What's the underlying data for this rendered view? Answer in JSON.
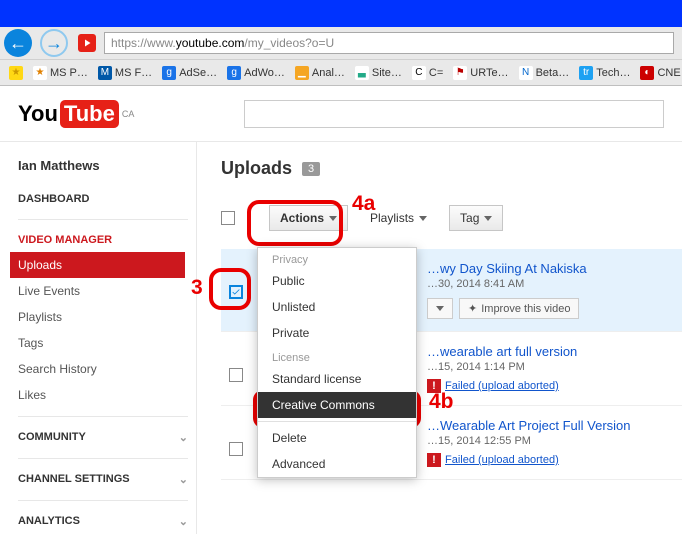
{
  "browser": {
    "url_scheme": "https://",
    "url_sub": "www.",
    "url_host": "youtube.com",
    "url_path": "/my_videos?o=U",
    "bookmarks": [
      {
        "label": "MS P…",
        "bg": "#fff",
        "fg": "#e08000",
        "ic": "★"
      },
      {
        "label": "MS F…",
        "bg": "#0058a8",
        "fg": "#fff",
        "ic": "M"
      },
      {
        "label": "AdSe…",
        "bg": "#1a73e8",
        "fg": "#fff",
        "ic": "g"
      },
      {
        "label": "AdWo…",
        "bg": "#1a73e8",
        "fg": "#fff",
        "ic": "g"
      },
      {
        "label": "Anal…",
        "bg": "#f5a623",
        "fg": "#fff",
        "ic": "▁"
      },
      {
        "label": "Site…",
        "bg": "#fff",
        "fg": "#2a8",
        "ic": "▃"
      },
      {
        "label": "C=",
        "bg": "#fff",
        "fg": "#000",
        "ic": "C"
      },
      {
        "label": "URTe…",
        "bg": "#fff",
        "fg": "#b00",
        "ic": "⚑"
      },
      {
        "label": "Beta…",
        "bg": "#fff",
        "fg": "#06c",
        "ic": "N"
      },
      {
        "label": "Tech…",
        "bg": "#1da1f2",
        "fg": "#fff",
        "ic": "tr"
      },
      {
        "label": "CNE…",
        "bg": "#cc0000",
        "fg": "#fff",
        "ic": "◐"
      }
    ]
  },
  "logo": {
    "you": "You",
    "tube": "Tube",
    "cc": "CA"
  },
  "sidebar": {
    "user": "Ian Matthews",
    "dashboard": "DASHBOARD",
    "video_manager": "VIDEO MANAGER",
    "items": [
      "Uploads",
      "Live Events",
      "Playlists",
      "Tags",
      "Search History",
      "Likes"
    ],
    "community": "COMMUNITY",
    "channel": "CHANNEL SETTINGS",
    "analytics": "ANALYTICS"
  },
  "main": {
    "title": "Uploads",
    "count": "3",
    "actions": "Actions",
    "playlists": "Playlists",
    "tag": "Tag",
    "improve": "Improve this video"
  },
  "dropdown": {
    "privacy": "Privacy",
    "public": "Public",
    "unlisted": "Unlisted",
    "private": "Private",
    "license": "License",
    "standard": "Standard license",
    "cc": "Creative Commons",
    "delete": "Delete",
    "advanced": "Advanced"
  },
  "videos": [
    {
      "title": "…wy Day Skiing At Nakiska",
      "meta": "…30, 2014 8:41 AM",
      "highlight": true,
      "checked": true,
      "failed": false
    },
    {
      "title": "…wearable art full version",
      "meta": "…15, 2014 1:14 PM",
      "highlight": false,
      "checked": false,
      "failed": true,
      "error": "Failed (upload aborted)"
    },
    {
      "title": "…Wearable Art Project Full Version",
      "meta": "…15, 2014 12:55 PM",
      "highlight": false,
      "checked": false,
      "failed": true,
      "error": "Failed (upload aborted)"
    }
  ],
  "annotations": {
    "a3": "3",
    "a4a": "4a",
    "a4b": "4b"
  }
}
